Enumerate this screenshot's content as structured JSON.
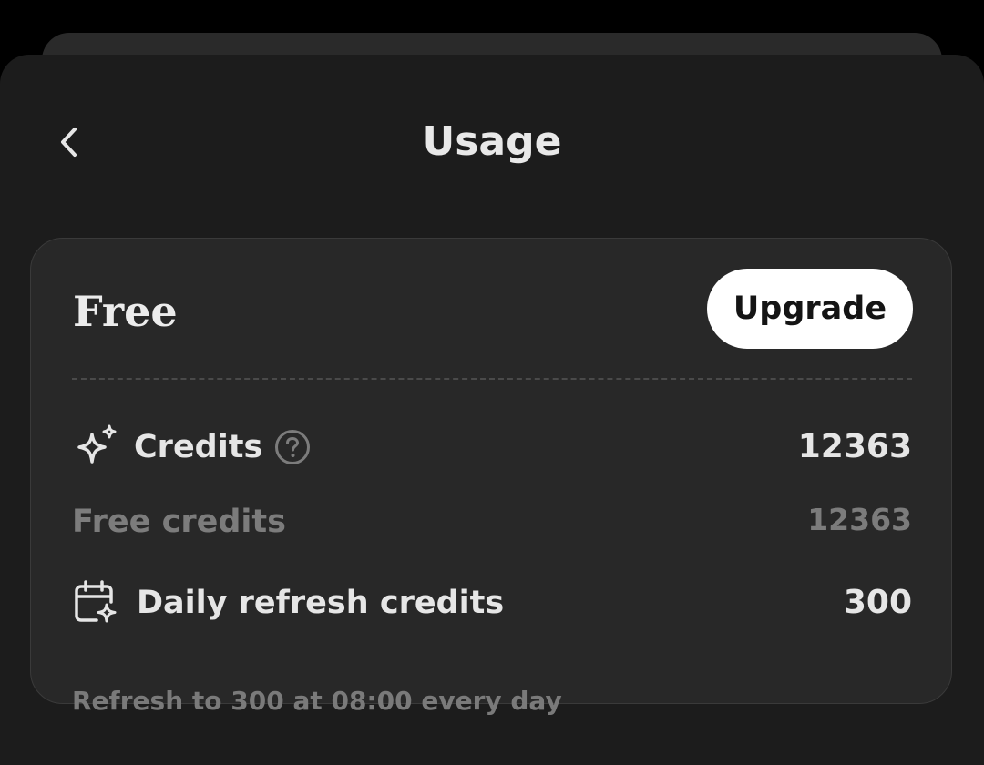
{
  "header": {
    "title": "Usage",
    "back_icon": "chevron-left-icon"
  },
  "plan": {
    "name": "Free",
    "upgrade_label": "Upgrade"
  },
  "credits": {
    "label": "Credits",
    "value": "12363",
    "icon": "sparkle-icon",
    "help_icon": "question-circle-icon"
  },
  "free_credits": {
    "label": "Free credits",
    "value": "12363"
  },
  "daily_refresh": {
    "label": "Daily refresh credits",
    "value": "300",
    "icon": "calendar-sparkle-icon",
    "note": "Refresh to 300 at 08:00 every day"
  },
  "colors": {
    "background": "#1c1c1c",
    "card": "#282828",
    "text_primary": "#e6e6e6",
    "text_muted": "#7c7c7c",
    "button_bg": "#ffffff",
    "button_text": "#141414"
  }
}
